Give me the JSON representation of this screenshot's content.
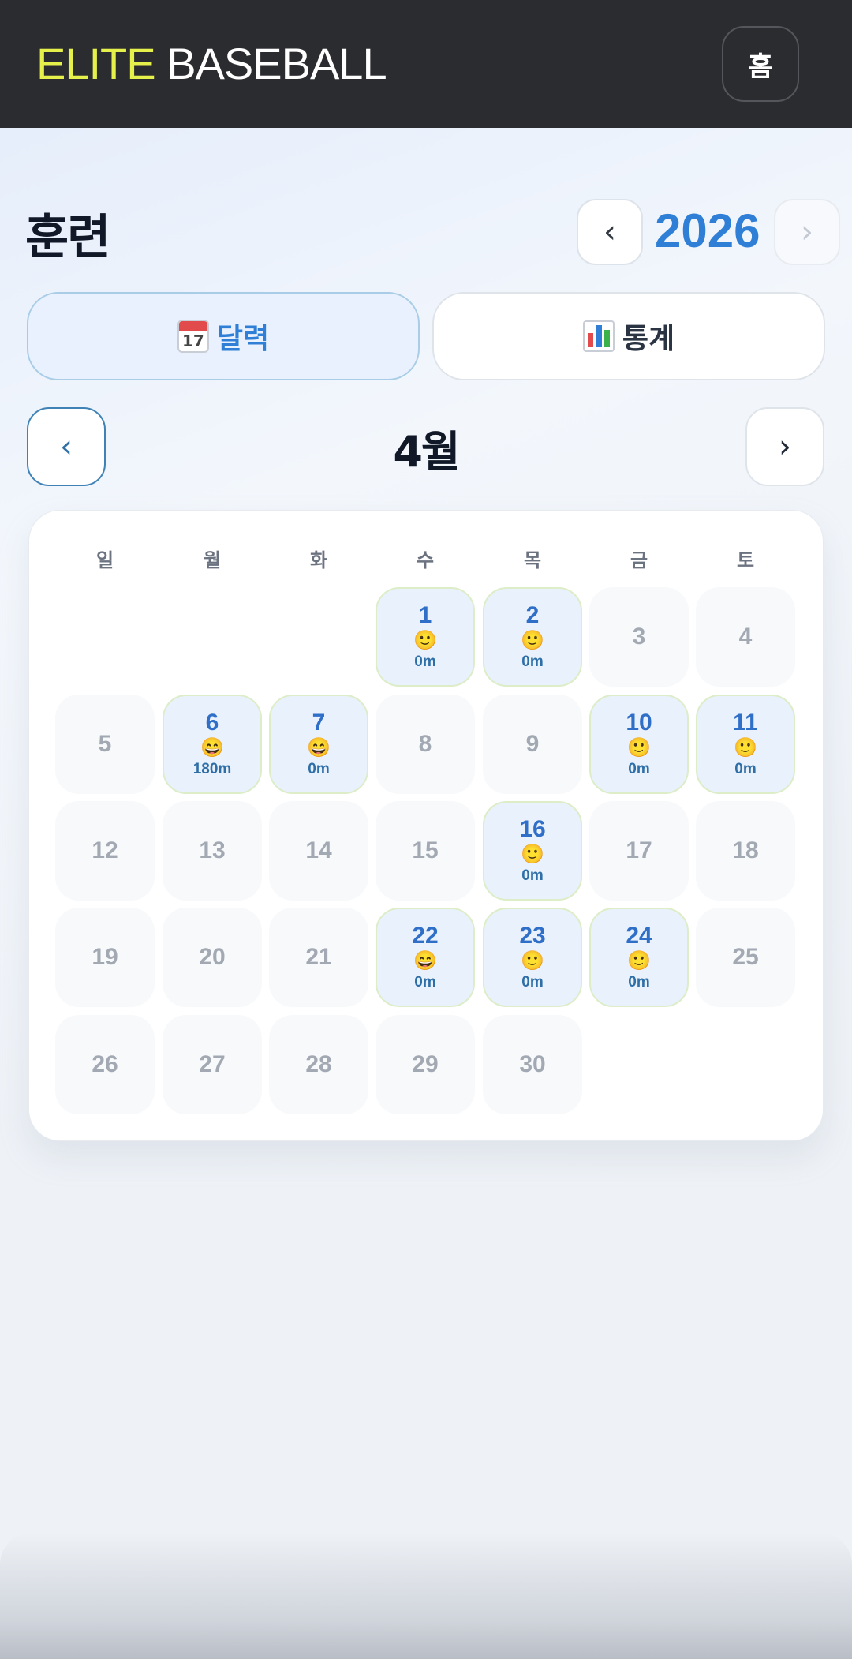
{
  "header": {
    "brand_primary": "ELITE",
    "brand_secondary": "BASEBALL",
    "home_label": "홈",
    "brand_color": "#e6f04a",
    "background_color": "#2b2c30"
  },
  "page": {
    "title": "훈련",
    "year": "2026",
    "year_prev_icon": "‹",
    "year_next_icon": "›",
    "accent_color": "#2f7fd6"
  },
  "tabs": [
    {
      "label": "달력",
      "icon": "calendar-icon",
      "active": true
    },
    {
      "label": "통계",
      "icon": "bar-chart-icon",
      "active": false
    }
  ],
  "calendar": {
    "month_label": "4월",
    "prev_icon": "‹",
    "next_icon": "›",
    "weekdays": [
      "일",
      "월",
      "화",
      "수",
      "목",
      "금",
      "토"
    ],
    "days": [
      {
        "day": "1",
        "face": "🙂",
        "minutes": "0m"
      },
      {
        "day": "2",
        "face": "🙂",
        "minutes": "0m"
      },
      {
        "day": "3"
      },
      {
        "day": "4"
      },
      {
        "day": "5"
      },
      {
        "day": "6",
        "face": "😄",
        "minutes": "180m"
      },
      {
        "day": "7",
        "face": "😄",
        "minutes": "0m"
      },
      {
        "day": "8"
      },
      {
        "day": "9"
      },
      {
        "day": "10",
        "face": "🙂",
        "minutes": "0m"
      },
      {
        "day": "11",
        "face": "🙂",
        "minutes": "0m"
      },
      {
        "day": "12"
      },
      {
        "day": "13"
      },
      {
        "day": "14"
      },
      {
        "day": "15"
      },
      {
        "day": "16",
        "face": "🙂",
        "minutes": "0m"
      },
      {
        "day": "17"
      },
      {
        "day": "18"
      },
      {
        "day": "19"
      },
      {
        "day": "20"
      },
      {
        "day": "21"
      },
      {
        "day": "22",
        "face": "😄",
        "minutes": "0m"
      },
      {
        "day": "23",
        "face": "🙂",
        "minutes": "0m"
      },
      {
        "day": "24",
        "face": "🙂",
        "minutes": "0m"
      },
      {
        "day": "25"
      },
      {
        "day": "26"
      },
      {
        "day": "27"
      },
      {
        "day": "28"
      },
      {
        "day": "29"
      },
      {
        "day": "30"
      }
    ]
  }
}
